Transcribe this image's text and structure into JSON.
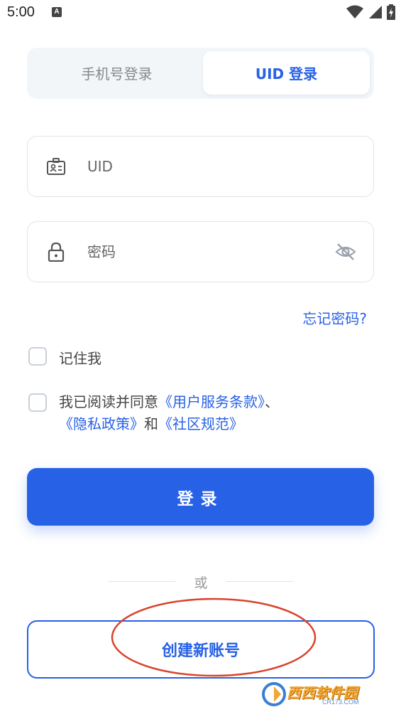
{
  "status_bar": {
    "time": "5:00",
    "notif_letter": "A"
  },
  "tabs": [
    {
      "label": "手机号登录",
      "active": false
    },
    {
      "label": "UID 登录",
      "active": true
    }
  ],
  "uid_field": {
    "placeholder": "UID",
    "value": "",
    "icon": "id-card-icon"
  },
  "password_field": {
    "placeholder": "密码",
    "value": "",
    "icon": "lock-icon",
    "toggle_icon": "eye-off-icon"
  },
  "forgot_password": "忘记密码?",
  "remember_me": {
    "label": "记住我",
    "checked": false
  },
  "agreement": {
    "checked": false,
    "prefix": "我已阅读并同意",
    "terms": "《用户服务条款》",
    "sep": "、",
    "privacy": "《隐私政策》",
    "and": "和",
    "community": "《社区规范》"
  },
  "login_button": "登录",
  "or_text": "或",
  "create_account_button": "创建新账号",
  "watermark": {
    "text": "西西软件园",
    "sub": "CR173.COM"
  },
  "colors": {
    "accent": "#2761e6",
    "annotation": "#d9432d",
    "border": "#dfe5ea"
  }
}
